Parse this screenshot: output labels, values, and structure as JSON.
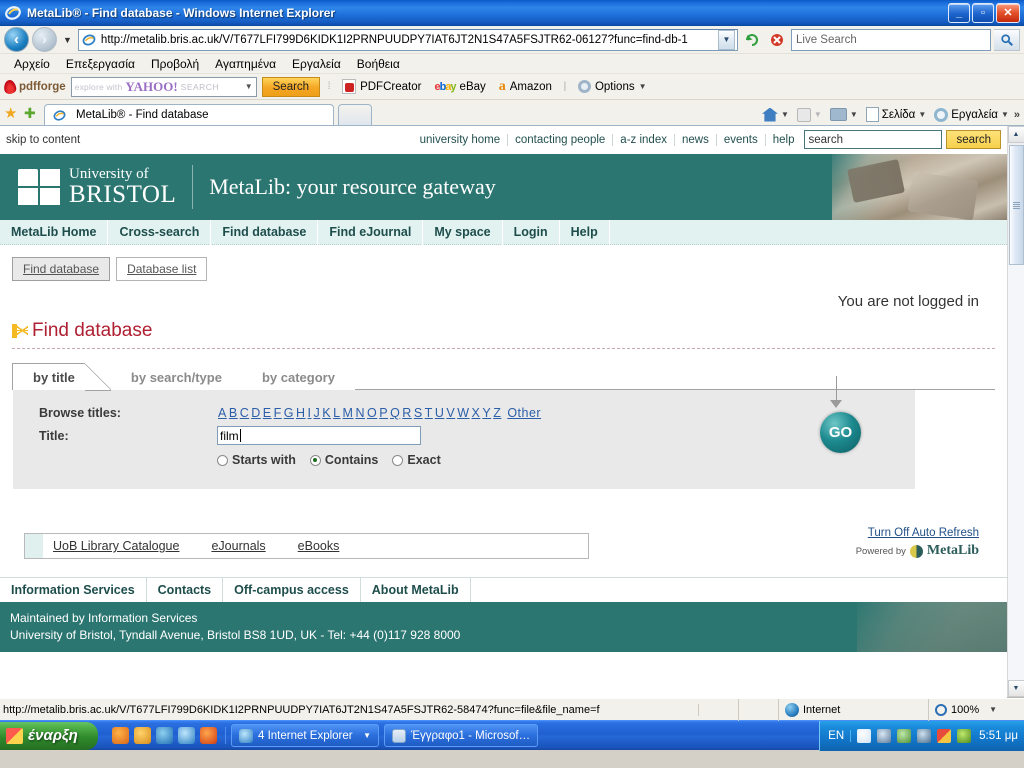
{
  "window": {
    "title": "MetaLib® - Find database - Windows Internet Explorer",
    "icon": "ie-logo-icon",
    "minimize": "_",
    "maximize": "▫",
    "close": "✕"
  },
  "address_bar": {
    "back": "‹",
    "forward": "›",
    "url": "http://metalib.bris.ac.uk/V/T677LFI799D6KIDK1I2PRNPUUDPY7IAT6JT2N1S47A5FSJTR62-06127?func=find-db-1",
    "dropdown": "▼",
    "refresh_icon": "refresh-icon",
    "stop_icon": "stop-icon",
    "search_placeholder": "Live Search",
    "search_value": "",
    "search_go": "🔍"
  },
  "menu": {
    "items": [
      {
        "label": "Αρχείο"
      },
      {
        "label": "Επεξεργασία"
      },
      {
        "label": "Προβολή"
      },
      {
        "label": "Αγαπημένα"
      },
      {
        "label": "Εργαλεία"
      },
      {
        "label": "Βοήθεια"
      }
    ]
  },
  "yahoo_toolbar": {
    "brand": "pdfforge",
    "input_hint": "explore with",
    "yahoo_logo": "YAHOO!",
    "search_word": "SEARCH",
    "caret": "▼",
    "search_button": "Search",
    "buttons": [
      {
        "label": "PDFCreator",
        "icon": "pdf-icon"
      },
      {
        "label": "eBay",
        "icon": "ebay-icon"
      },
      {
        "label": "Amazon",
        "icon": "amazon-icon"
      },
      {
        "label": "Options",
        "icon": "gear-icon",
        "caret": "▼"
      }
    ]
  },
  "tab_bar": {
    "favorites_icon": "star-icon",
    "add_favorite_icon": "add-star-icon",
    "tab_title": "MetaLib® - Find database",
    "new_tab": "",
    "command_bar": [
      {
        "label": "",
        "icon": "home-icon",
        "caret": "▼"
      },
      {
        "label": "",
        "icon": "rss-icon",
        "caret": "▼"
      },
      {
        "label": "",
        "icon": "print-icon",
        "caret": "▼"
      },
      {
        "label": "Σελίδα",
        "icon": "page-icon",
        "caret": "▼"
      },
      {
        "label": "Εργαλεία",
        "icon": "gear-icon",
        "caret": "▼"
      }
    ],
    "overflow": "»"
  },
  "page": {
    "utility_bar": {
      "skip": "skip to content",
      "links": [
        "university home",
        "contacting people",
        "a-z index",
        "news",
        "events",
        "help"
      ],
      "search_value": "search",
      "search_button": "search"
    },
    "banner": {
      "university_line1": "University of",
      "university_line2": "BRISTOL",
      "title": "MetaLib: your resource gateway"
    },
    "main_nav": [
      "MetaLib Home",
      "Cross-search",
      "Find database",
      "Find eJournal",
      "My space",
      "Login",
      "Help"
    ],
    "subtabs": [
      {
        "label": "Find database",
        "active": true
      },
      {
        "label": "Database list",
        "active": false
      }
    ],
    "login_status": "You are not logged in",
    "page_title": "Find database",
    "search_tabs": [
      {
        "label": "by title",
        "active": true
      },
      {
        "label": "by search/type",
        "active": false
      },
      {
        "label": "by category",
        "active": false
      }
    ],
    "form": {
      "browse_label": "Browse titles:",
      "alphabet": [
        "A",
        "B",
        "C",
        "D",
        "E",
        "F",
        "G",
        "H",
        "I",
        "J",
        "K",
        "L",
        "M",
        "N",
        "O",
        "P",
        "Q",
        "R",
        "S",
        "T",
        "U",
        "V",
        "W",
        "X",
        "Y",
        "Z"
      ],
      "other_link": "Other",
      "title_label": "Title:",
      "title_value": "film",
      "options": [
        {
          "label": "Starts with",
          "selected": false
        },
        {
          "label": "Contains",
          "selected": true
        },
        {
          "label": "Exact",
          "selected": false
        }
      ],
      "go_button": "GO"
    },
    "quick_links": [
      "UoB Library Catalogue",
      "eJournals",
      "eBooks"
    ],
    "auto_refresh": "Turn Off Auto Refresh",
    "powered_by": "Powered by",
    "powered_brand": "MetaLib",
    "footer_nav": [
      "Information Services",
      "Contacts",
      "Off-campus access",
      "About MetaLib"
    ],
    "footer_line1": "Maintained by Information Services",
    "footer_line2": "University of Bristol, Tyndall Avenue, Bristol BS8 1UD, UK - Tel: +44 (0)117 928 8000"
  },
  "scrollbar": {
    "up": "▲",
    "down": "▼"
  },
  "status_bar": {
    "url": "http://metalib.bris.ac.uk/V/T677LFI799D6KIDK1I2PRNPUUDPY7IAT6JT2N1S47A5FSJTR62-58474?func=file&file_name=f",
    "zone": "Internet",
    "zoom": "100%",
    "zoom_caret": "▼"
  },
  "taskbar": {
    "start": "έναρξη",
    "quick_launch": [
      "media-player-icon",
      "clock-icon",
      "ie-small-icon",
      "ie-icon",
      "firefox-icon"
    ],
    "tasks": [
      {
        "label": "4 Internet Explorer",
        "icon": "ie-icon",
        "caret": "▼"
      },
      {
        "label": "Έγγραφο1 - Microsof…",
        "icon": "word-icon"
      }
    ],
    "language": "EN",
    "tray_icons": [
      "network-icon",
      "usb-icon",
      "disk-icon",
      "volume-icon",
      "update-icon",
      "nvidia-icon"
    ],
    "clock": "5:51 μμ"
  },
  "colors": {
    "teal": "#2c7671",
    "teal_light": "#e2f2f1",
    "title_red": "#b02033",
    "accent_yellow": "#f5b921",
    "panel_grey": "#e9e9e9"
  }
}
